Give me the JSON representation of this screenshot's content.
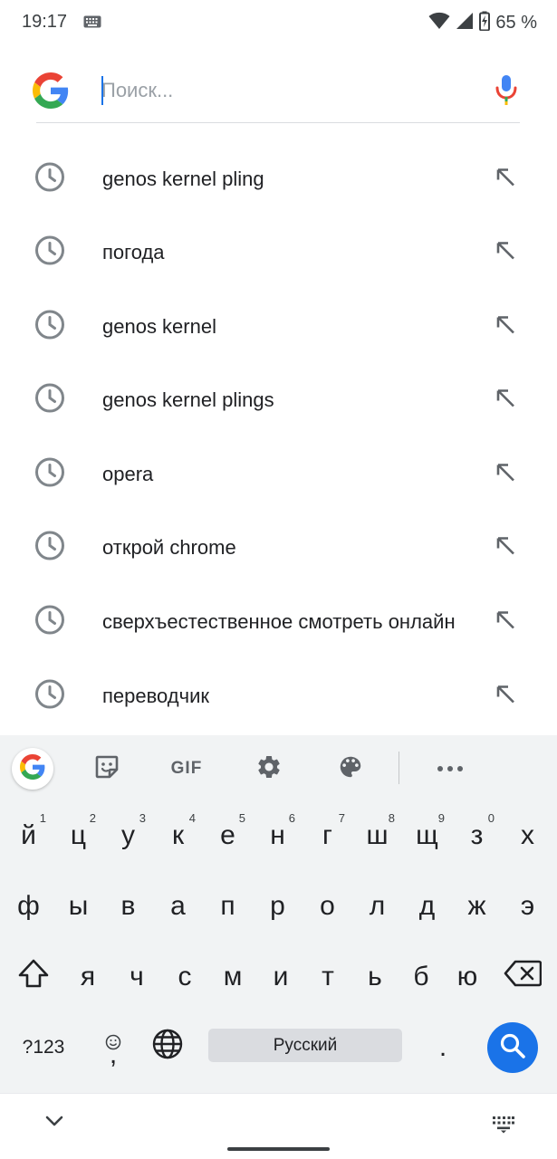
{
  "status_bar": {
    "time": "19:17",
    "battery_percent": "65 %",
    "icons": [
      "keyboard-icon",
      "wifi-icon",
      "signal-icon",
      "battery-charging-icon"
    ]
  },
  "search": {
    "placeholder": "Поиск...",
    "value": "",
    "logo_icon": "google-g-icon",
    "voice_icon": "mic-icon"
  },
  "suggestions": [
    {
      "text": "genos kernel pling",
      "icon": "history-clock-icon",
      "action_icon": "fill-query-arrow-icon"
    },
    {
      "text": "погода",
      "icon": "history-clock-icon",
      "action_icon": "fill-query-arrow-icon"
    },
    {
      "text": "genos kernel",
      "icon": "history-clock-icon",
      "action_icon": "fill-query-arrow-icon"
    },
    {
      "text": "genos kernel plings",
      "icon": "history-clock-icon",
      "action_icon": "fill-query-arrow-icon"
    },
    {
      "text": "opera",
      "icon": "history-clock-icon",
      "action_icon": "fill-query-arrow-icon"
    },
    {
      "text": "открой chrome",
      "icon": "history-clock-icon",
      "action_icon": "fill-query-arrow-icon"
    },
    {
      "text": "сверхъестественное смотреть онлайн",
      "icon": "history-clock-icon",
      "action_icon": "fill-query-arrow-icon"
    },
    {
      "text": "переводчик",
      "icon": "history-clock-icon",
      "action_icon": "fill-query-arrow-icon"
    }
  ],
  "keyboard": {
    "toolbar": {
      "gif_label": "GIF",
      "icons": [
        "google-g-icon",
        "sticker-icon",
        "gif-icon",
        "settings-gear-icon",
        "palette-icon",
        "more-icon"
      ]
    },
    "row1": [
      {
        "key": "й",
        "hint": "1"
      },
      {
        "key": "ц",
        "hint": "2"
      },
      {
        "key": "у",
        "hint": "3"
      },
      {
        "key": "к",
        "hint": "4"
      },
      {
        "key": "е",
        "hint": "5"
      },
      {
        "key": "н",
        "hint": "6"
      },
      {
        "key": "г",
        "hint": "7"
      },
      {
        "key": "ш",
        "hint": "8"
      },
      {
        "key": "щ",
        "hint": "9"
      },
      {
        "key": "з",
        "hint": "0"
      },
      {
        "key": "х",
        "hint": ""
      }
    ],
    "row2": [
      "ф",
      "ы",
      "в",
      "а",
      "п",
      "р",
      "о",
      "л",
      "д",
      "ж",
      "э"
    ],
    "row3": [
      "я",
      "ч",
      "с",
      "м",
      "и",
      "т",
      "ь",
      "б",
      "ю"
    ],
    "row4": {
      "symbols_label": "?123",
      "comma_label": ",",
      "space_label": "Русский",
      "period_label": "."
    }
  },
  "navigation": {
    "icons": [
      "chevron-down-icon",
      "home-handle",
      "keyboard-switch-icon"
    ]
  }
}
